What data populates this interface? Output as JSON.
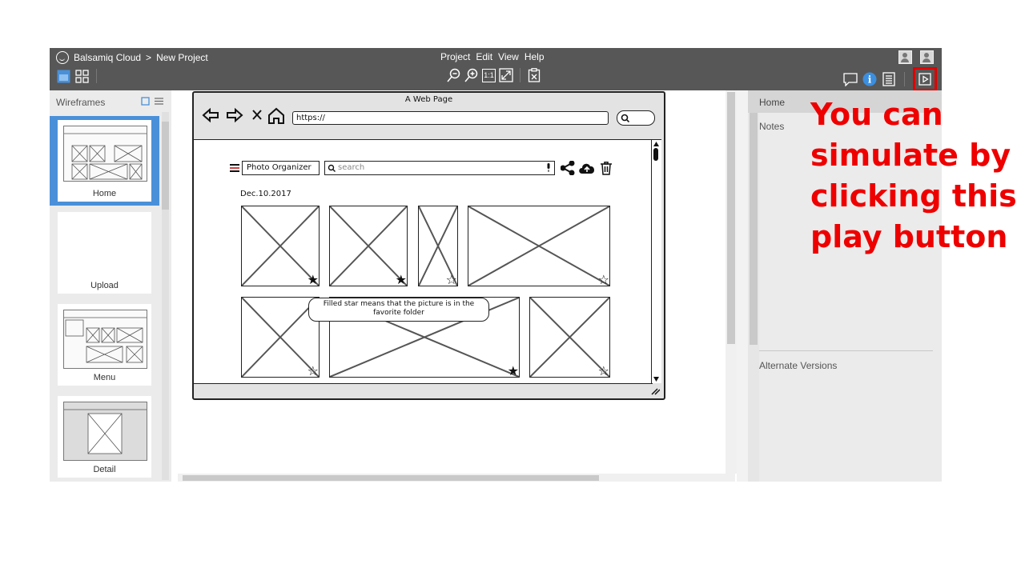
{
  "app": {
    "brand": "Balsamiq Cloud",
    "separator": ">",
    "project": "New Project",
    "menu": [
      "Project",
      "Edit",
      "View",
      "Help"
    ]
  },
  "toolbar": {
    "zoom_out_icon": "zoom-out-icon",
    "zoom_in_icon": "zoom-in-icon",
    "actual_size_label": "1:1",
    "fit_icon": "fit-screen-icon",
    "clipboard_icon": "clipboard-icon",
    "comments_icon": "comment-icon",
    "info_icon": "info-icon",
    "notes_icon": "list-icon",
    "play_icon": "play-icon"
  },
  "left_panel": {
    "title": "Wireframes",
    "thumbnails": [
      {
        "label": "Home",
        "selected": true
      },
      {
        "label": "Upload",
        "selected": false
      },
      {
        "label": "Menu",
        "selected": false
      },
      {
        "label": "Detail",
        "selected": false
      }
    ]
  },
  "wireframe": {
    "window_title": "A Web Page",
    "url": "https://",
    "app_button": "Photo Organizer",
    "search_placeholder": "search",
    "date": "Dec.10.2017",
    "tooltip": "Filled star means that the picture is in the favorite folder",
    "photos_row1_stars": [
      "filled",
      "filled",
      "empty",
      "empty"
    ],
    "photos_row2_stars": [
      "empty",
      "filled",
      "empty"
    ]
  },
  "right_panel": {
    "page": "Home",
    "notes_label": "Notes",
    "alternate_label": "Alternate Versions"
  },
  "annotation": {
    "text": "You can simulate by clicking this play button",
    "color": "#ee0000"
  }
}
